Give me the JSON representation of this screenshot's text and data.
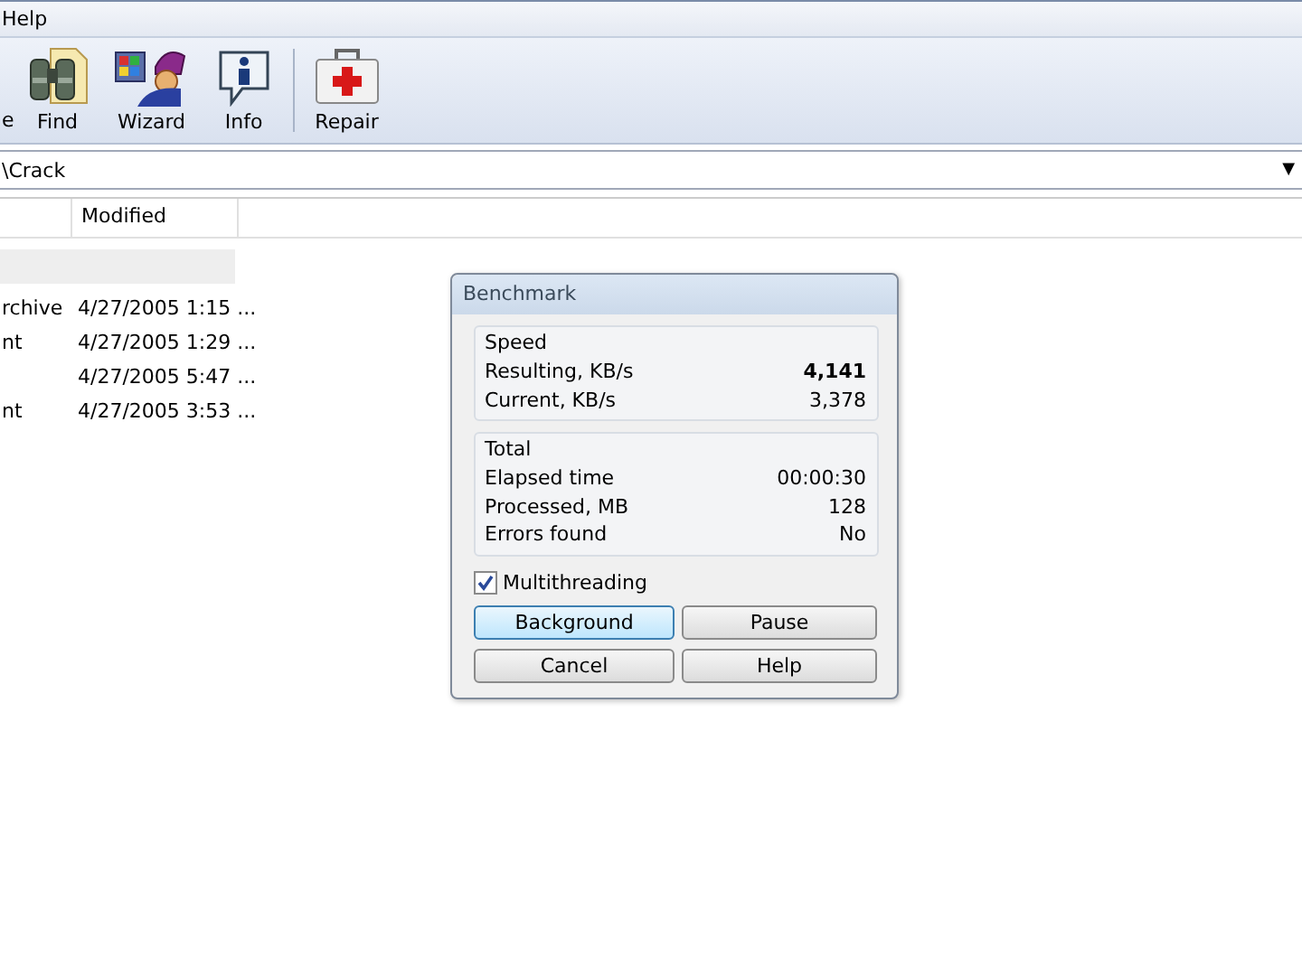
{
  "menu_bar": {
    "items": [
      "Help"
    ]
  },
  "toolbar": {
    "buttons": [
      {
        "kind": "cut",
        "label": "e"
      },
      {
        "kind": "find",
        "label": "Find"
      },
      {
        "kind": "wizard",
        "label": "Wizard"
      },
      {
        "kind": "info",
        "label": "Info"
      },
      {
        "kind": "repair",
        "label": "Repair"
      }
    ]
  },
  "address_bar": {
    "path": "\\Crack",
    "dropdown": "▼"
  },
  "file_list": {
    "columns": [
      "",
      "Modified"
    ],
    "rows": [
      {
        "selected": true
      },
      {
        "selected": false,
        "name": "rchive",
        "modified": "4/27/2005 1:15 ..."
      },
      {
        "selected": false,
        "name": "nt",
        "modified": "4/27/2005 1:29 ..."
      },
      {
        "selected": false,
        "modified": "4/27/2005 5:47 ..."
      },
      {
        "selected": false,
        "name": "nt",
        "modified": "4/27/2005 3:53 ..."
      }
    ]
  },
  "dialog": {
    "title": "Benchmark",
    "groups": [
      {
        "title": "Speed",
        "rows": [
          {
            "label": "Resulting, KB/s",
            "value": "4,141",
            "bold": true
          },
          {
            "label": "Current, KB/s",
            "value": "3,378",
            "bold": false
          }
        ]
      },
      {
        "title": "Total",
        "rows": [
          {
            "label": "Elapsed time",
            "value": "00:00:30",
            "bold": false
          },
          {
            "label": "Processed, MB",
            "value": "128",
            "bold": false
          },
          {
            "label": "Errors found",
            "value": "No",
            "bold": false
          }
        ]
      }
    ],
    "multithreading": {
      "label": "Multithreading",
      "checked": true
    },
    "buttons": [
      {
        "label": "Background",
        "default": true
      },
      {
        "label": "Pause",
        "default": false
      },
      {
        "label": "Cancel",
        "default": false
      },
      {
        "label": "Help",
        "default": false
      }
    ]
  }
}
